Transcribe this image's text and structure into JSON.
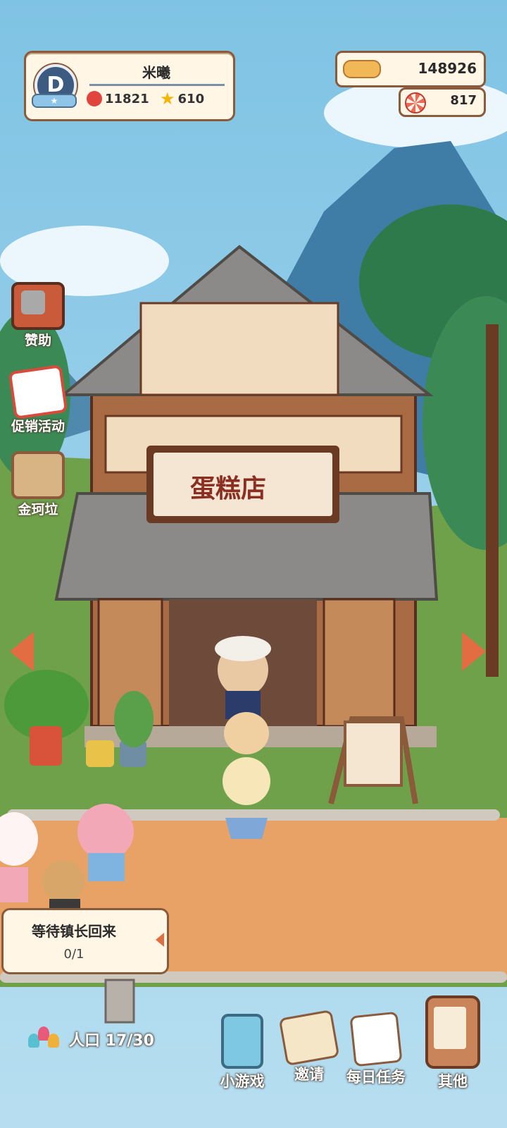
{
  "profile": {
    "level_letter": "D",
    "name": "米曦",
    "hearts": "11821",
    "stars": "610"
  },
  "currency": {
    "bones": "148926",
    "candy": "817"
  },
  "side_menu": [
    {
      "label": "赞助",
      "icon": "tv-icon"
    },
    {
      "label": "促销活动",
      "icon": "sale-icon"
    },
    {
      "label": "金珂垃",
      "icon": "bag-icon"
    }
  ],
  "building_sign": {
    "text": "蛋糕店"
  },
  "task": {
    "title": "等待镇长回来",
    "progress": "0/1"
  },
  "population": {
    "label": "人口 17/30"
  },
  "dock": {
    "minigame": "小游戏",
    "invite": "邀请",
    "daily_tasks": "每日任务",
    "other": "其他"
  },
  "colors": {
    "sky": "#86c7e6",
    "mountain": "#3f7da6",
    "grass": "#6fa04a",
    "path": "#e9a266",
    "wood": "#8b5a3a",
    "accent": "#e36d42"
  }
}
